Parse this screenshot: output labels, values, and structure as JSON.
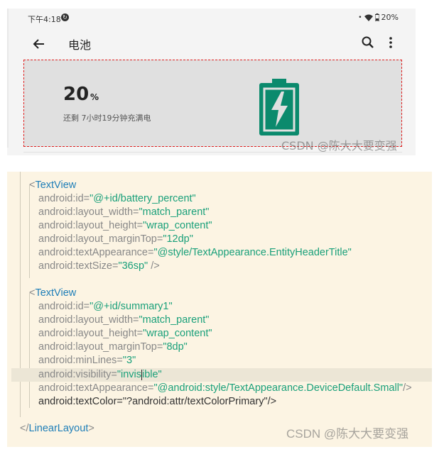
{
  "status_bar": {
    "time": "下午4:18",
    "sync_icon": "sync-icon",
    "battery_text": "20%"
  },
  "app_bar": {
    "title": "电池",
    "back_icon": "arrow-left-icon",
    "search_icon": "search-icon",
    "more_icon": "more-vert-icon"
  },
  "battery_header": {
    "percent": "20",
    "percent_sign": "%",
    "summary": "还剩 7小时19分钟充满电",
    "icon": "battery-charging-icon",
    "icon_color": "#0b8a6d"
  },
  "watermark": "CSDN @陈大大要变强",
  "code": {
    "tv1": {
      "open": "<",
      "tag": "TextView",
      "id_attr": "android:id=",
      "id_val": "\"@+id/battery_percent\"",
      "w_attr": "android:layout_width=",
      "w_val": "\"match_parent\"",
      "h_attr": "android:layout_height=",
      "h_val": "\"wrap_content\"",
      "mt_attr": "android:layout_marginTop=",
      "mt_val": "\"12dp\"",
      "ta_attr": "android:textAppearance=",
      "ta_val": "\"@style/TextAppearance.EntityHeaderTitle\"",
      "ts_attr": "android:textSize=",
      "ts_val": "\"36sp\"",
      "close": " />"
    },
    "tv2": {
      "open": "<",
      "tag": "TextView",
      "id_attr": "android:id=",
      "id_val": "\"@+id/summary1\"",
      "w_attr": "android:layout_width=",
      "w_val": "\"match_parent\"",
      "h_attr": "android:layout_height=",
      "h_val": "\"wrap_content\"",
      "mt_attr": "android:layout_marginTop=",
      "mt_val": "\"8dp\"",
      "ml_attr": "android:minLines=",
      "ml_val": "\"3\"",
      "vis_attr": "android:visibility=",
      "vis_val_a": "\"invis",
      "vis_val_b": "ible\"",
      "ta_attr": "android:textAppearance=",
      "ta_val": "\"@android:style/TextAppearance.DeviceDefault.Small\"",
      "ta_close": "/>",
      "tc_line": "android:textColor=\"?android:attr/textColorPrimary\"/>"
    },
    "closing": {
      "open": "</",
      "tag": "LinearLayout",
      "close": ">"
    }
  }
}
